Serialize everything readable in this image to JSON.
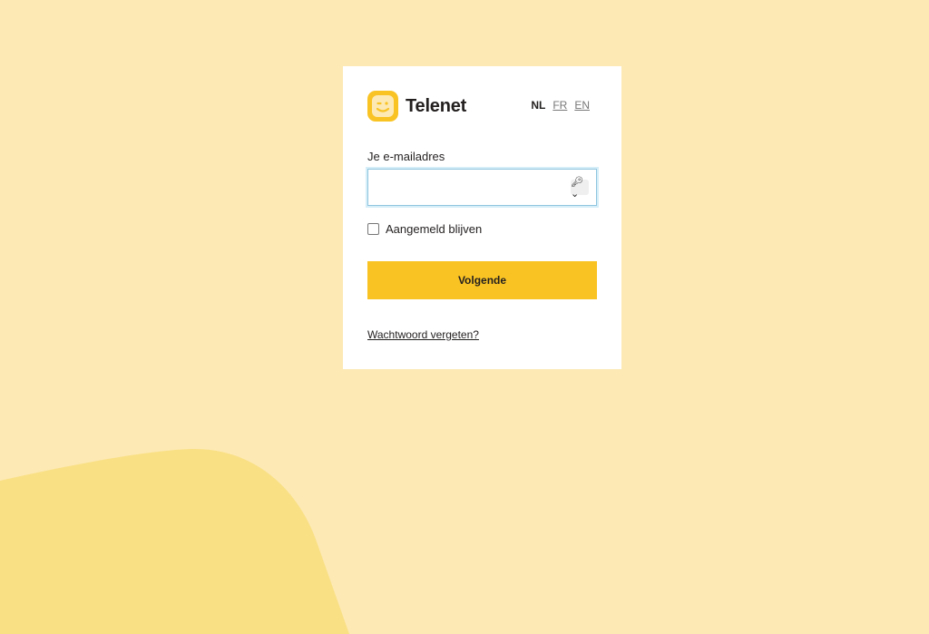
{
  "brand": {
    "name": "Telenet",
    "colors": {
      "background": "#fde9b4",
      "blob": "#f9e085",
      "accent": "#f9c323",
      "logo": "#f9c323"
    }
  },
  "languages": [
    {
      "code": "NL",
      "active": true
    },
    {
      "code": "FR",
      "active": false
    },
    {
      "code": "EN",
      "active": false
    }
  ],
  "form": {
    "email_label": "Je e-mailadres",
    "email_value": "",
    "email_placeholder": "",
    "password_manager_icon": "key-icon",
    "remember_label": "Aangemeld blijven",
    "remember_checked": false,
    "submit_label": "Volgende",
    "forgot_label": "Wachtwoord vergeten?"
  }
}
